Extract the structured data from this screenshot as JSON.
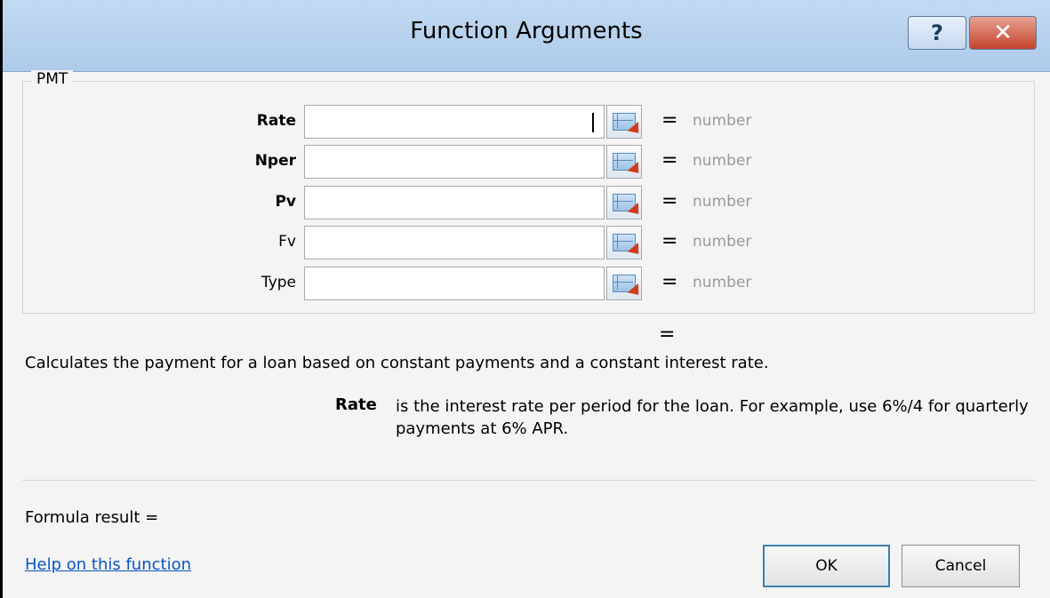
{
  "window": {
    "title": "Function Arguments",
    "help_glyph": "?",
    "close_glyph": "✕"
  },
  "group": {
    "label": "PMT",
    "args": [
      {
        "label": "Rate",
        "bold": true,
        "value": "",
        "result": "number"
      },
      {
        "label": "Nper",
        "bold": true,
        "value": "",
        "result": "number"
      },
      {
        "label": "Pv",
        "bold": true,
        "value": "",
        "result": "number"
      },
      {
        "label": "Fv",
        "bold": false,
        "value": "",
        "result": "number"
      },
      {
        "label": "Type",
        "bold": false,
        "value": "",
        "result": "number"
      }
    ],
    "eq_sign": "="
  },
  "function_result_eq": "=",
  "description": "Calculates the payment for a loan based on constant payments and a constant interest rate.",
  "arg_help": {
    "name": "Rate",
    "text": "is the interest rate per period for the loan. For example, use 6%/4 for quarterly payments at 6% APR."
  },
  "formula_result_label": "Formula result =",
  "help_link": "Help on this function",
  "buttons": {
    "ok": "OK",
    "cancel": "Cancel"
  },
  "colors": {
    "link": "#0a54c4",
    "result_text": "#9a9a9a",
    "titlebar": "#c2d9f1",
    "close_button": "#c4432c"
  },
  "icons": {
    "collapse_dialog": "collapse-dialog-icon",
    "help": "help-icon",
    "close": "close-icon"
  }
}
